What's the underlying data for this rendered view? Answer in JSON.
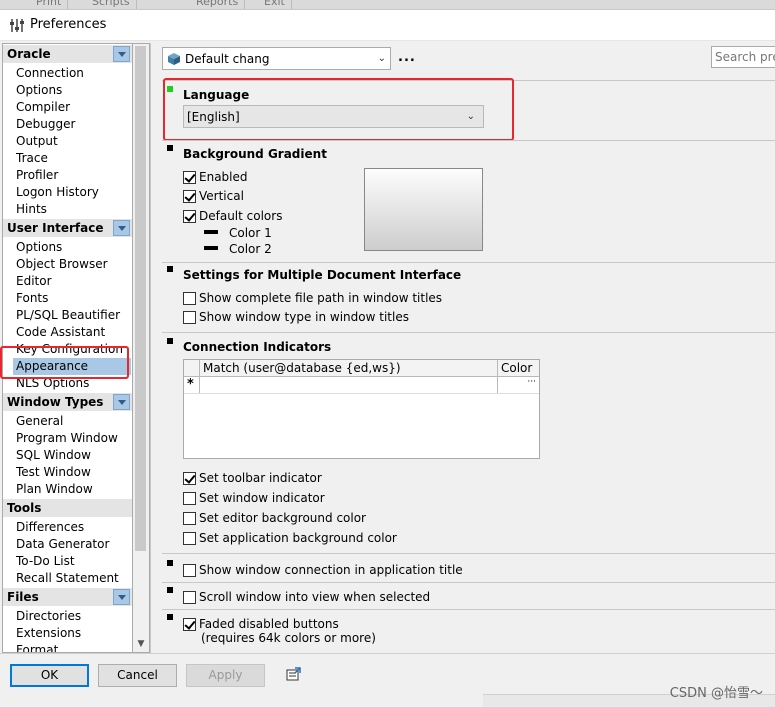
{
  "background_tabs": [
    "Print",
    "Scripts",
    "Reports",
    "Exit"
  ],
  "window": {
    "title": "Preferences"
  },
  "sidebar": {
    "categories": [
      {
        "label": "Oracle",
        "items": [
          "Connection",
          "Options",
          "Compiler",
          "Debugger",
          "Output",
          "Trace",
          "Profiler",
          "Logon History",
          "Hints"
        ]
      },
      {
        "label": "User Interface",
        "items": [
          "Options",
          "Object Browser",
          "Editor",
          "Fonts",
          "PL/SQL Beautifier",
          "Code Assistant",
          "Key Configuration",
          "Appearance",
          "NLS Options"
        ]
      },
      {
        "label": "Window Types",
        "items": [
          "General",
          "Program Window",
          "SQL Window",
          "Test Window",
          "Plan Window"
        ]
      },
      {
        "label": "Tools",
        "items": [
          "Differences",
          "Data Generator",
          "To-Do List",
          "Recall Statement"
        ]
      },
      {
        "label": "Files",
        "items": [
          "Directories",
          "Extensions",
          "Format"
        ]
      }
    ],
    "selected": "Appearance"
  },
  "toolbar": {
    "profile_value": "Default chang",
    "more_label": "...",
    "search_placeholder": "Search prefe"
  },
  "language": {
    "title": "Language",
    "value": "[English]"
  },
  "background_gradient": {
    "title": "Background Gradient",
    "enabled_label": "Enabled",
    "vertical_label": "Vertical",
    "default_colors_label": "Default colors",
    "color1_label": "Color 1",
    "color2_label": "Color 2",
    "enabled": true,
    "vertical": true,
    "default_colors": true
  },
  "mdi": {
    "title": "Settings for Multiple Document Interface",
    "show_path_label": "Show complete file path in window titles",
    "show_type_label": "Show window type in window titles",
    "show_path": false,
    "show_type": false
  },
  "connection_indicators": {
    "title": "Connection Indicators",
    "columns": [
      "Match (user@database {ed,ws})",
      "Color"
    ],
    "new_row_marker": "*",
    "row_button": "···",
    "set_toolbar_label": "Set toolbar indicator",
    "set_window_label": "Set window indicator",
    "set_editor_bg_label": "Set editor background color",
    "set_app_bg_label": "Set application background color",
    "set_toolbar": true,
    "set_window": false,
    "set_editor_bg": false,
    "set_app_bg": false
  },
  "options": {
    "show_conn_title_label": "Show window connection in application title",
    "scroll_into_view_label": "Scroll window into view when selected",
    "faded_label": "Faded disabled buttons",
    "faded_note": "(requires 64k colors or more)",
    "show_conn_title": false,
    "scroll_into_view": false,
    "faded": true
  },
  "buttons": {
    "ok": "OK",
    "cancel": "Cancel",
    "apply": "Apply"
  },
  "watermark": "CSDN @怡雪～",
  "colors": {
    "selection": "#a9c8e6",
    "highlight_red": "#e8262b",
    "marker_green": "#22cc22",
    "default_border": "#0078d7"
  }
}
